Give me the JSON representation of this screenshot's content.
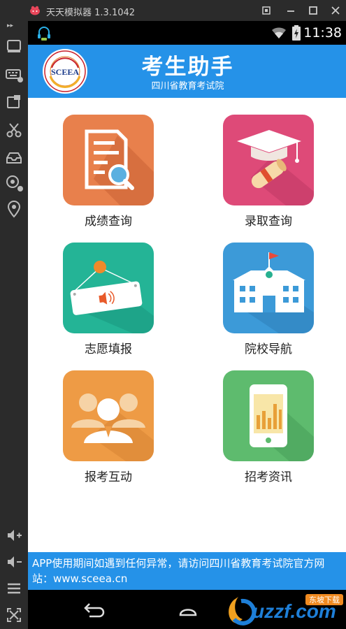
{
  "emulator": {
    "title": "天天模拟器 1.3.1042"
  },
  "status_bar": {
    "time": "11:38"
  },
  "header": {
    "title": "考生助手",
    "subtitle": "四川省教育考试院",
    "logo_text": "SCEEA"
  },
  "tiles": [
    {
      "label": "成绩查询",
      "color": "#e8804c",
      "icon": "report-search-icon"
    },
    {
      "label": "录取查询",
      "color": "#de4a78",
      "icon": "graduation-cap-icon"
    },
    {
      "label": "志愿填报",
      "color": "#24b496",
      "icon": "hanging-sign-icon"
    },
    {
      "label": "院校导航",
      "color": "#3c9ad8",
      "icon": "school-building-icon"
    },
    {
      "label": "报考互动",
      "color": "#ee9b45",
      "icon": "people-group-icon"
    },
    {
      "label": "招考资讯",
      "color": "#5ebb6e",
      "icon": "phone-chart-icon"
    }
  ],
  "notice": {
    "text": "APP使用期间如遇到任何异常，请访问四川省教育考试院官方网站：www.sceea.cn"
  },
  "watermark": {
    "text": "uzzf.com",
    "subtext": "东坡下载"
  },
  "colors": {
    "header_blue": "#2592e8",
    "emulator_gray": "#2b2b2b"
  }
}
